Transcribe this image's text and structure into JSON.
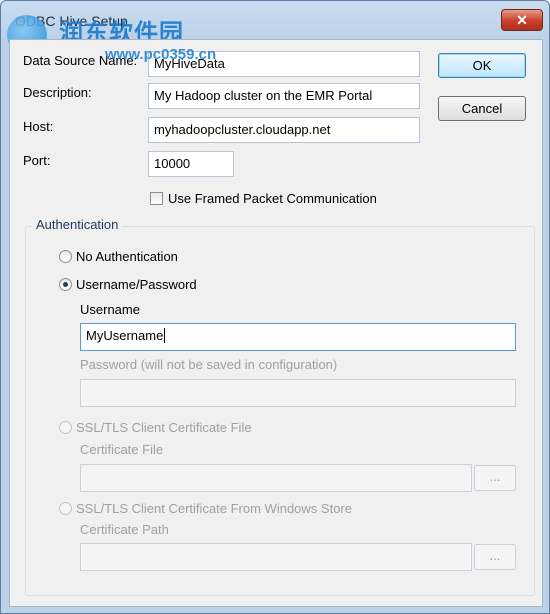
{
  "window": {
    "title": "ODBC Hive Setup",
    "close_label": "✕"
  },
  "watermark": {
    "site": "润东软件园",
    "url": "www.pc0359.cn"
  },
  "fields": {
    "dsn_label": "Data Source Name:",
    "dsn_value": "MyHiveData",
    "description_label": "Description:",
    "description_value": "My Hadoop cluster on the EMR Portal",
    "host_label": "Host:",
    "host_value": "myhadoopcluster.cloudapp.net",
    "port_label": "Port:",
    "port_value": "10000"
  },
  "framed_packet": {
    "label": "Use Framed Packet Communication",
    "checked": false
  },
  "buttons": {
    "ok": "OK",
    "cancel": "Cancel"
  },
  "auth": {
    "title": "Authentication",
    "no_auth": "No Authentication",
    "userpass": "Username/Password",
    "selected": "userpass",
    "username_label": "Username",
    "username_value": "MyUsername",
    "password_label": "Password (will not be saved in configuration)",
    "password_value": "",
    "ssl_file": "SSL/TLS Client Certificate File",
    "cert_file_label": "Certificate File",
    "cert_file_value": "",
    "ssl_store": "SSL/TLS Client Certificate From Windows Store",
    "cert_path_label": "Certificate Path",
    "cert_path_value": "",
    "browse_label": "..."
  }
}
